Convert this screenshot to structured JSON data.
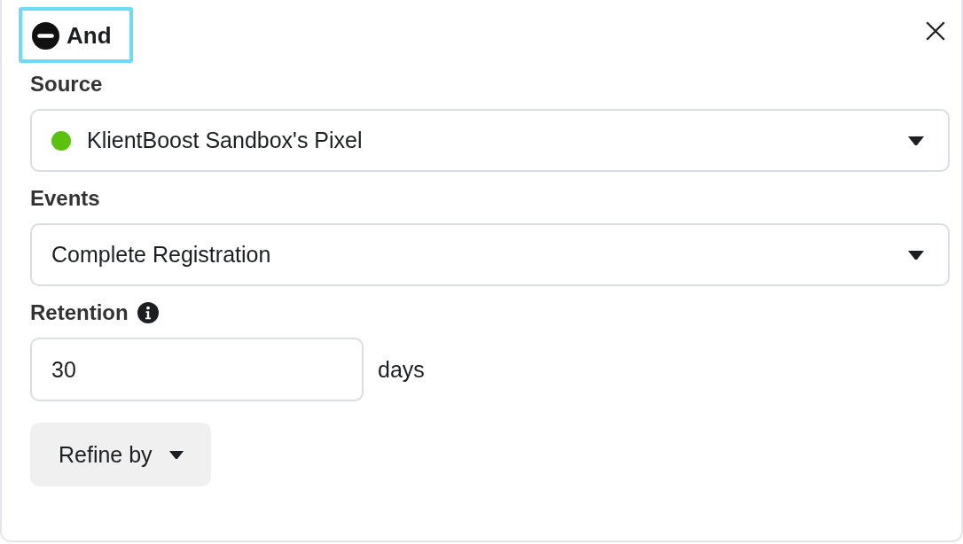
{
  "header": {
    "label": "And",
    "highlighted": true
  },
  "source": {
    "label": "Source",
    "value": "KlientBoost Sandbox's Pixel",
    "color": "#5ac10c"
  },
  "events": {
    "label": "Events",
    "value": "Complete Registration"
  },
  "retention": {
    "label": "Retention",
    "value": "30",
    "unit": "days"
  },
  "refine_button": {
    "label": "Refine by"
  }
}
